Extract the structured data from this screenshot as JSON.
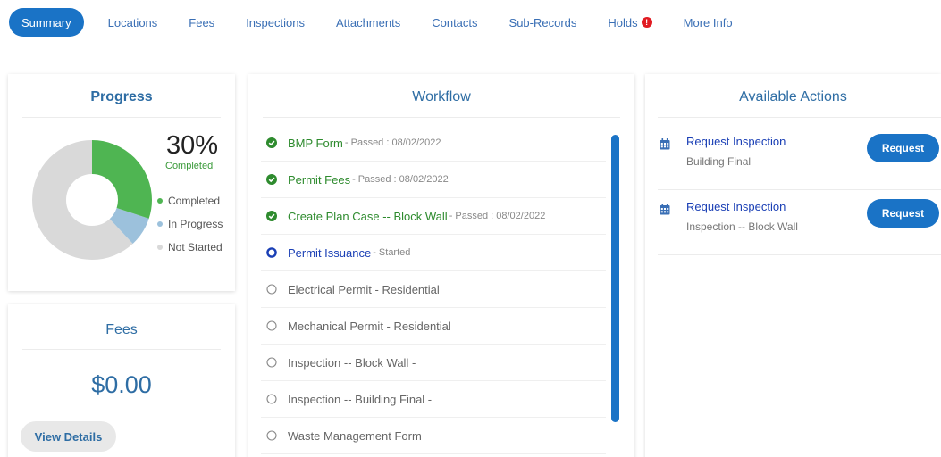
{
  "tabs": [
    {
      "label": "Summary",
      "active": true
    },
    {
      "label": "Locations"
    },
    {
      "label": "Fees"
    },
    {
      "label": "Inspections"
    },
    {
      "label": "Attachments"
    },
    {
      "label": "Contacts"
    },
    {
      "label": "Sub-Records"
    },
    {
      "label": "Holds",
      "badge": "!"
    },
    {
      "label": "More Info"
    }
  ],
  "progress": {
    "title": "Progress",
    "percent": "30%",
    "percent_label": "Completed",
    "legend": [
      "Completed",
      "In Progress",
      "Not Started"
    ],
    "segments": {
      "completed": 0.3,
      "in_progress": 0.08,
      "not_started": 0.62
    },
    "colors": {
      "completed": "#4fb552",
      "in_progress": "#9cc1dc",
      "not_started": "#d9d9d9"
    }
  },
  "fees": {
    "title": "Fees",
    "amount": "$0.00",
    "view_details_label": "View Details"
  },
  "workflow": {
    "title": "Workflow",
    "items": [
      {
        "name": "BMP Form",
        "status": " - Passed : 08/02/2022",
        "state": "done"
      },
      {
        "name": "Permit Fees",
        "status": " - Passed : 08/02/2022",
        "state": "done"
      },
      {
        "name": "Create Plan Case -- Block Wall",
        "status": " - Passed : 08/02/2022",
        "state": "done"
      },
      {
        "name": "Permit Issuance",
        "status": " - Started",
        "state": "current"
      },
      {
        "name": "Electrical Permit - Residential",
        "status": "",
        "state": "pending"
      },
      {
        "name": "Mechanical Permit - Residential",
        "status": "",
        "state": "pending"
      },
      {
        "name": "Inspection -- Block Wall -",
        "status": "",
        "state": "pending"
      },
      {
        "name": "Inspection -- Building Final -",
        "status": "",
        "state": "pending"
      },
      {
        "name": "Waste Management Form",
        "status": "",
        "state": "pending"
      }
    ]
  },
  "actions": {
    "title": "Available Actions",
    "items": [
      {
        "title": "Request Inspection",
        "subtitle": "Building Final",
        "button": "Request"
      },
      {
        "title": "Request Inspection",
        "subtitle": "Inspection -- Block Wall",
        "button": "Request"
      }
    ]
  },
  "colors": {
    "accent": "#1a73c6",
    "done": "#2e8b2e",
    "current": "#1a3fb5",
    "alert": "#e11b22"
  }
}
